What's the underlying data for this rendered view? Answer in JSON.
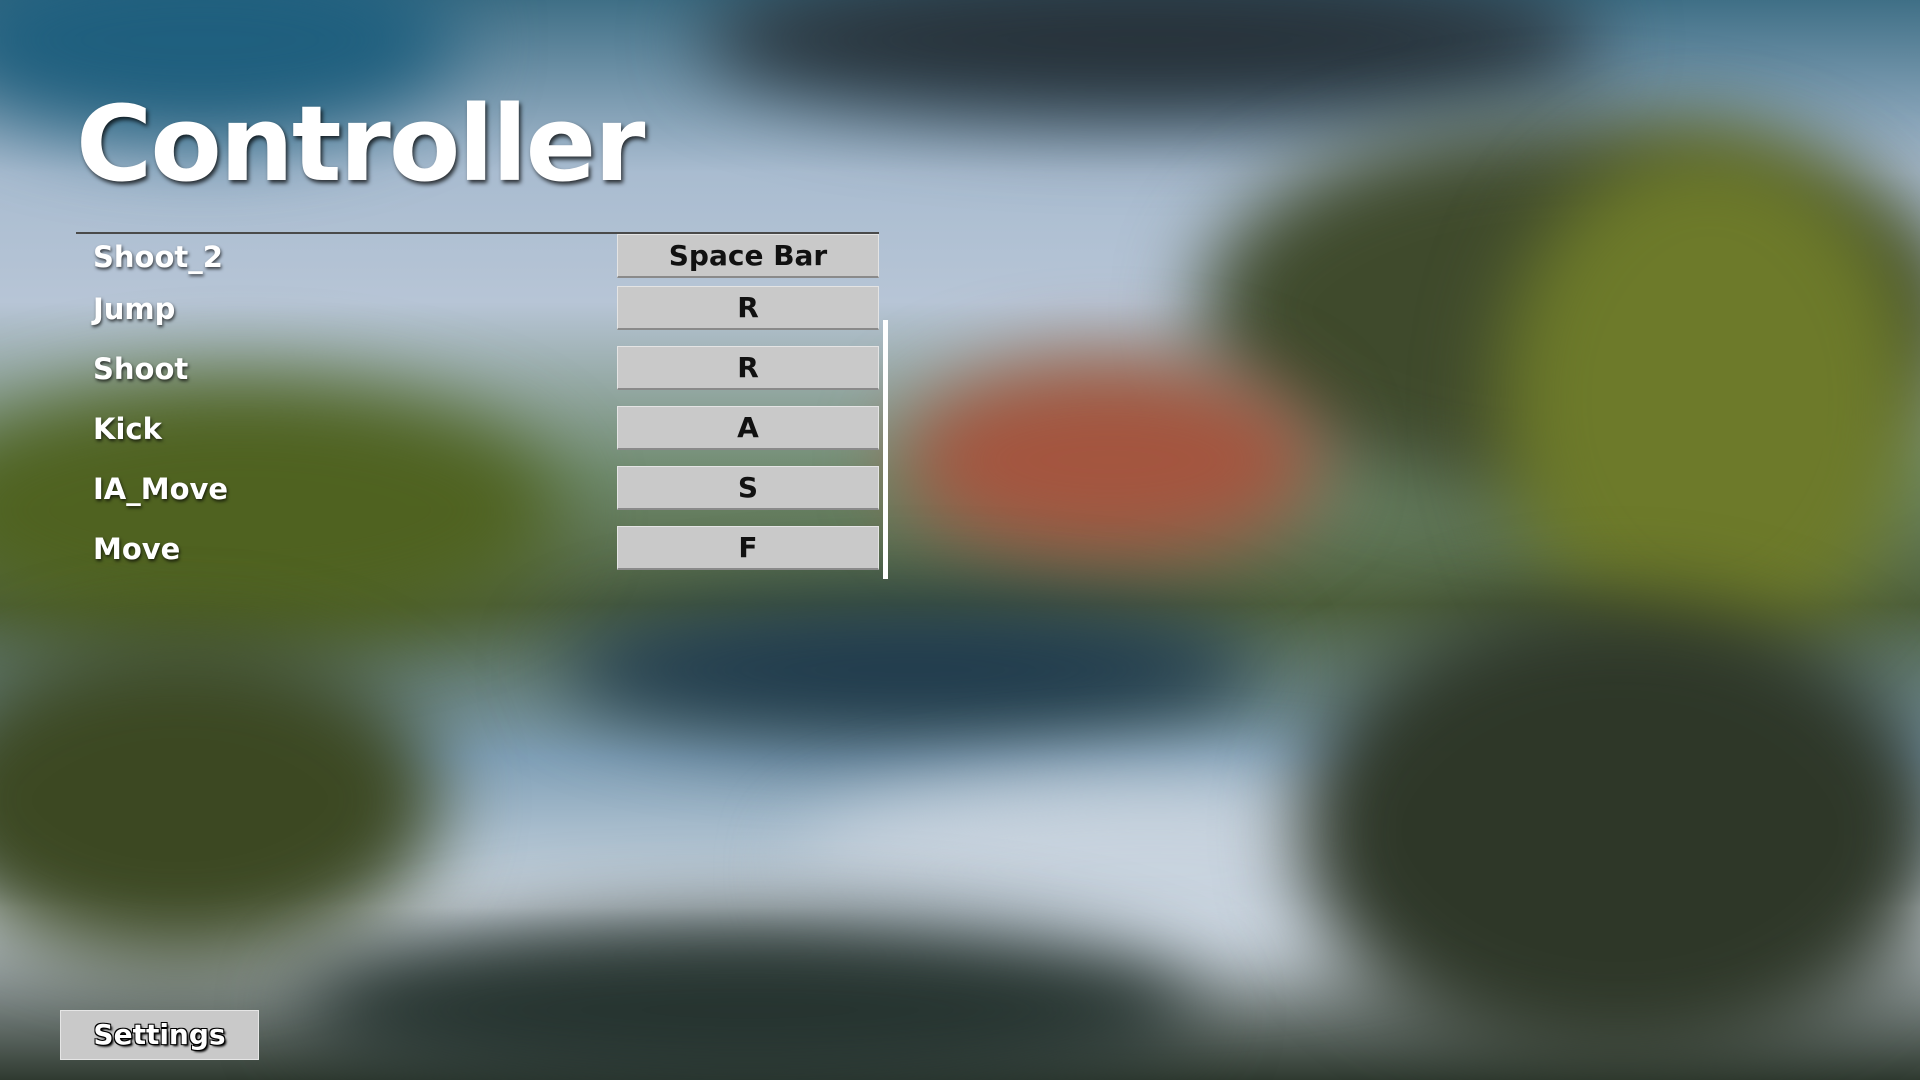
{
  "screen": {
    "title": "Controller"
  },
  "bindings": [
    {
      "action": "Shoot_2",
      "key": "Space Bar"
    },
    {
      "action": "Jump",
      "key": "R"
    },
    {
      "action": "Shoot",
      "key": "R"
    },
    {
      "action": "Kick",
      "key": "A"
    },
    {
      "action": "IA_Move",
      "key": "S"
    },
    {
      "action": "Move",
      "key": "F"
    }
  ],
  "footer": {
    "settings_label": "Settings"
  }
}
